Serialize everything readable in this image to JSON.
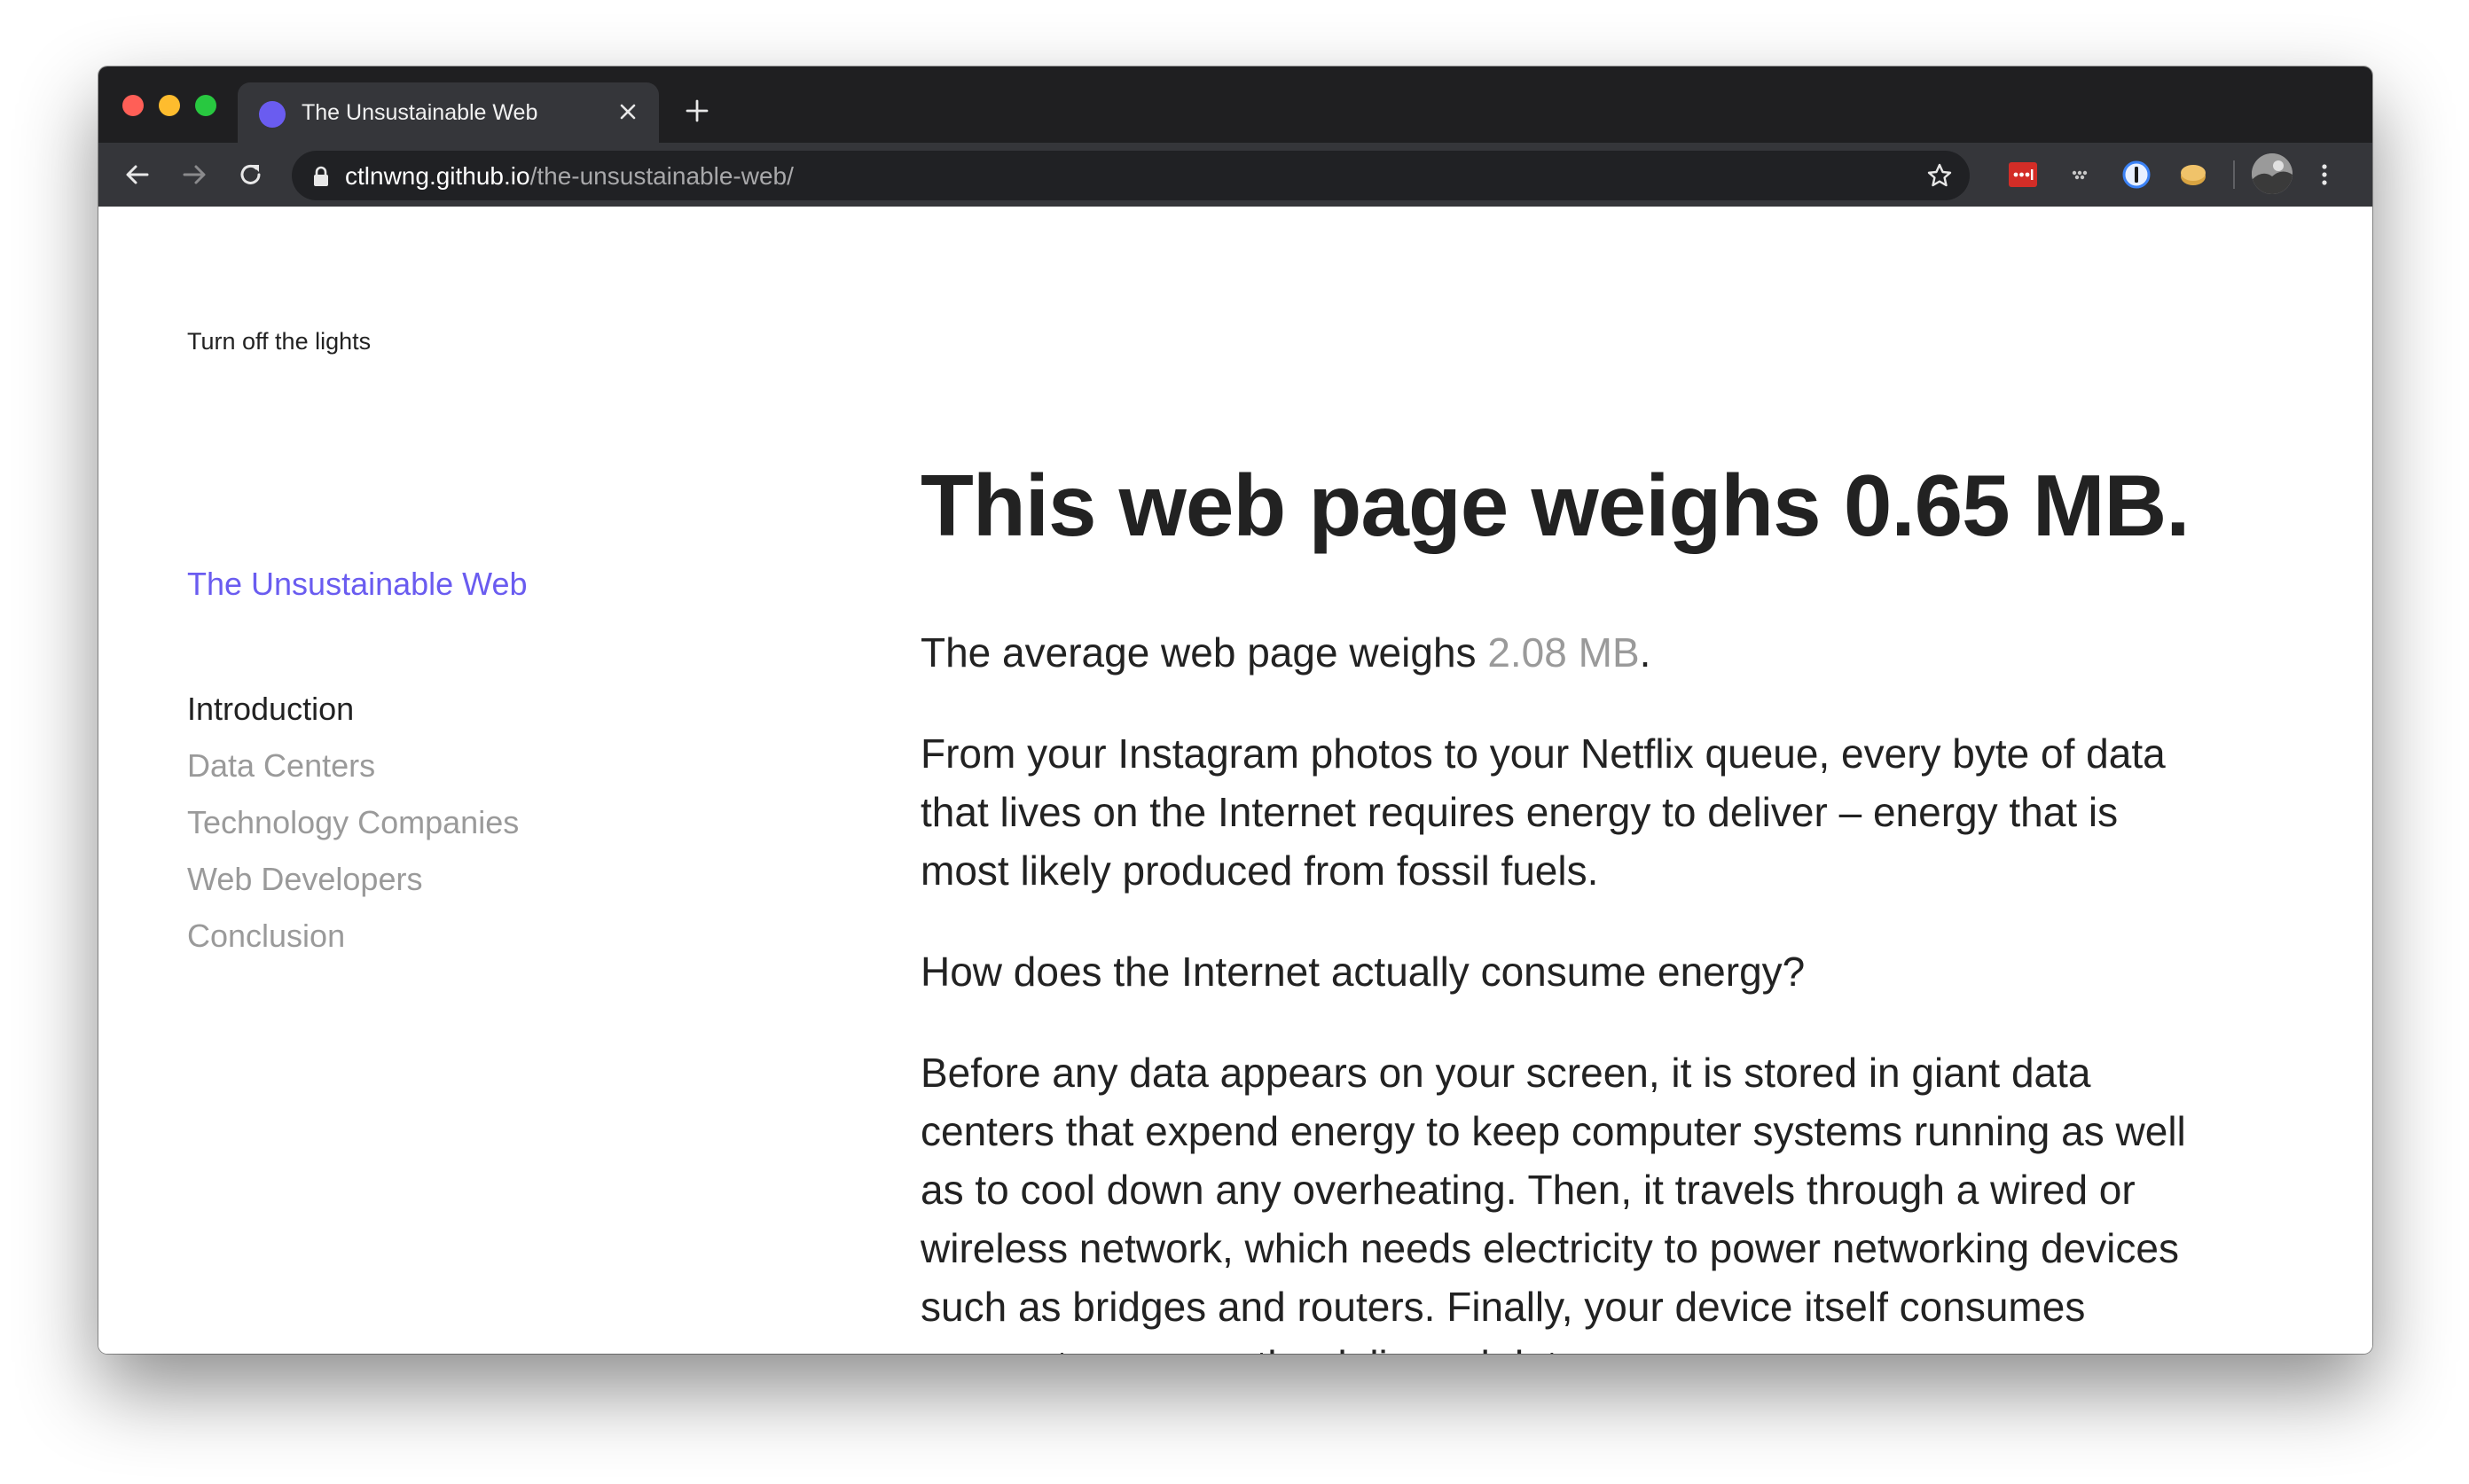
{
  "browser": {
    "tab": {
      "title": "The Unsustainable Web"
    },
    "url": {
      "host": "ctlnwng.github.io",
      "path": "/the-unsustainable-web/"
    },
    "icons": [
      "back-arrow-icon",
      "forward-arrow-icon",
      "reload-icon",
      "lock-icon",
      "star-icon",
      "lastpass-icon",
      "dots-icon",
      "onepassword-icon",
      "cookie-icon",
      "kebab-menu-icon"
    ],
    "colors": {
      "frame": "#1f1f21",
      "toolbar": "#35363a",
      "favicon": "#6a5cf0"
    }
  },
  "sidebar": {
    "lights_toggle": "Turn off the lights",
    "site_title": "The Unsustainable Web",
    "nav": [
      {
        "label": "Introduction",
        "active": true
      },
      {
        "label": "Data Centers",
        "active": false
      },
      {
        "label": "Technology Companies",
        "active": false
      },
      {
        "label": "Web Developers",
        "active": false
      },
      {
        "label": "Conclusion",
        "active": false
      }
    ]
  },
  "main": {
    "headline": "This web page weighs 0.65 MB.",
    "average": {
      "prefix": "The average web page weighs ",
      "value": "2.08 MB",
      "suffix": "."
    },
    "p2": "From your Instagram photos to your Netflix queue, every byte of data that lives on the Internet requires energy to deliver – energy that is most likely produced from fossil fuels.",
    "p3": "How does the Internet actually consume energy?",
    "p4": "Before any data appears on your screen, it is stored in giant data centers that expend energy to keep computer systems running as well as to cool down any overheating. Then, it travels through a wired or wireless network, which needs electricity to power networking devices such as bridges and routers. Finally, your device itself consumes energy to process the delivered data,"
  }
}
